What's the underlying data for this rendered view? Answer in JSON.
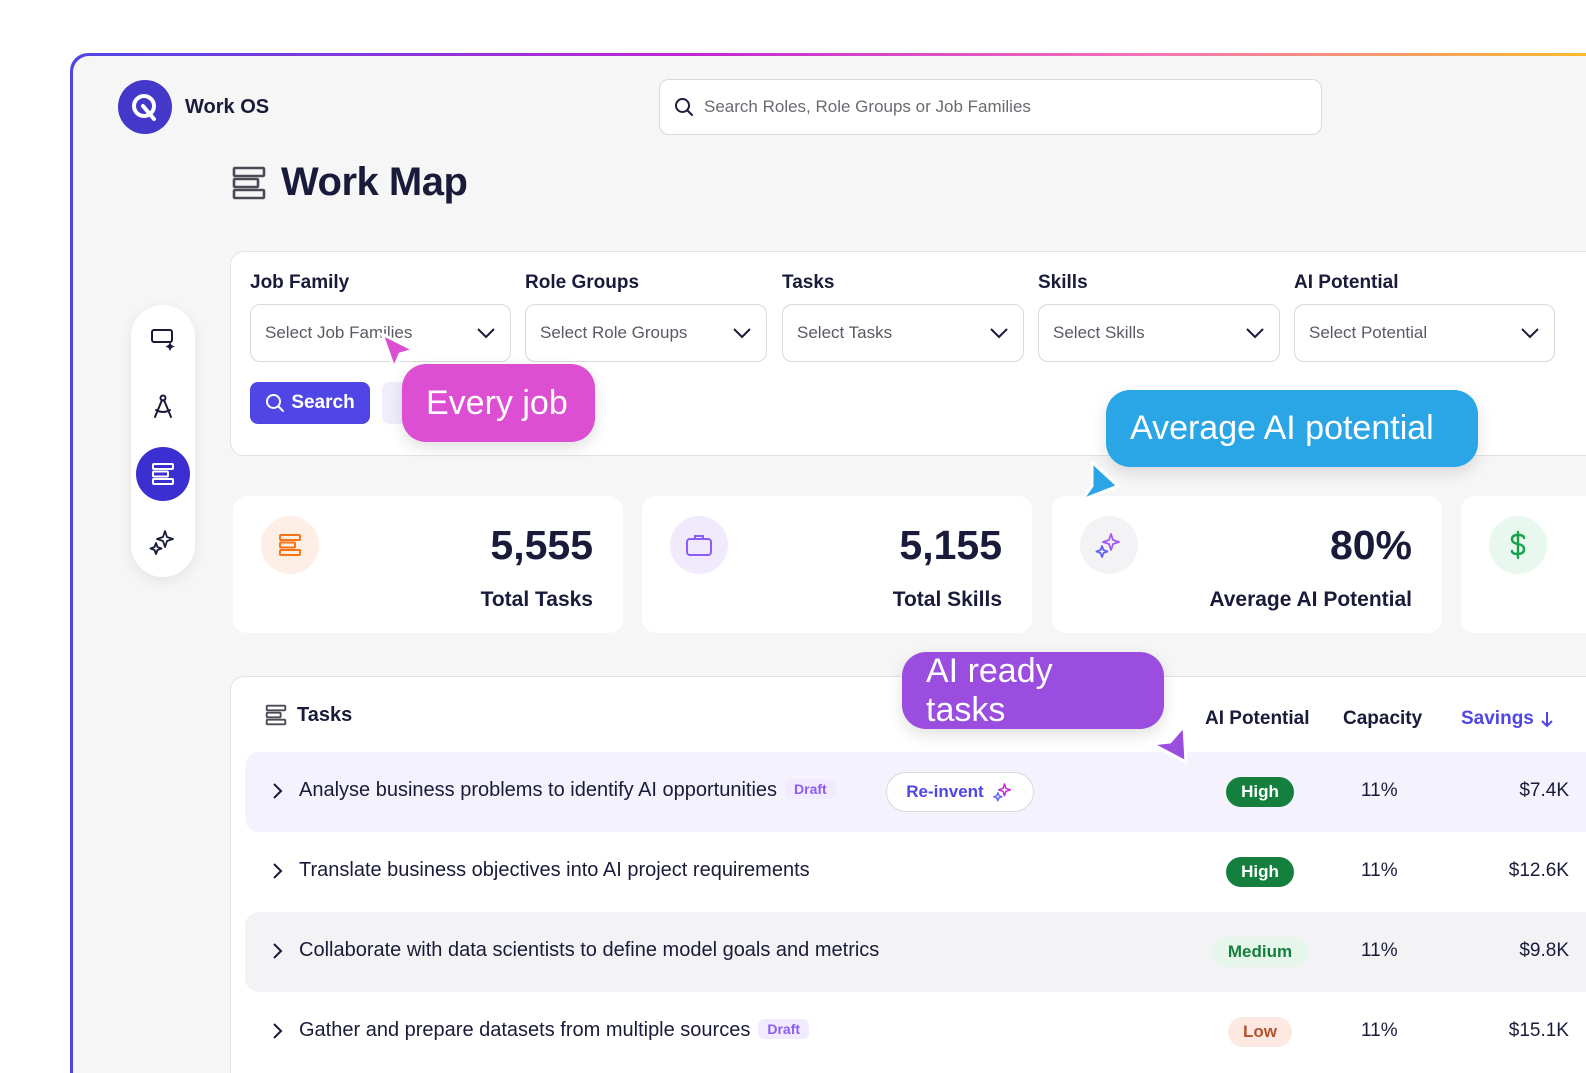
{
  "app": {
    "brand": "Work OS"
  },
  "search": {
    "placeholder": "Search Roles, Role Groups or Job Families"
  },
  "page": {
    "title": "Work Map"
  },
  "filters": [
    {
      "label": "Job Family",
      "placeholder": "Select Job Families"
    },
    {
      "label": "Role Groups",
      "placeholder": "Select Role Groups"
    },
    {
      "label": "Tasks",
      "placeholder": "Select Tasks"
    },
    {
      "label": "Skills",
      "placeholder": "Select Skills"
    },
    {
      "label": "AI Potential",
      "placeholder": "Select Potential"
    }
  ],
  "search_button": {
    "label": "Search"
  },
  "stats": [
    {
      "value": "5,555",
      "label": "Total Tasks",
      "icon": "stack-icon",
      "color": "#f97316"
    },
    {
      "value": "5,155",
      "label": "Total Skills",
      "icon": "briefcase-icon",
      "color": "#8b5cf6"
    },
    {
      "value": "80%",
      "label": "Average AI Potential",
      "icon": "sparkles-icon",
      "color": "#7c3aed"
    },
    {
      "value": "",
      "label": "",
      "icon": "dollar-icon",
      "color": "#16a34a"
    }
  ],
  "tasks": {
    "title": "Tasks",
    "columns": {
      "ai_potential": "AI Potential",
      "capacity": "Capacity",
      "savings": "Savings"
    },
    "rows": [
      {
        "name": "Analyse business problems to identify AI opportunities",
        "draft": "Draft",
        "action": "Re-invent",
        "potential": "High",
        "capacity": "11%",
        "savings": "$7.4K"
      },
      {
        "name": "Translate business objectives into AI project requirements",
        "draft": "",
        "action": "",
        "potential": "High",
        "capacity": "11%",
        "savings": "$12.6K"
      },
      {
        "name": "Collaborate with data scientists to define model goals and metrics",
        "draft": "",
        "action": "",
        "potential": "Medium",
        "capacity": "11%",
        "savings": "$9.8K"
      },
      {
        "name": "Gather and prepare datasets from multiple sources",
        "draft": "Draft",
        "action": "",
        "potential": "Low",
        "capacity": "11%",
        "savings": "$15.1K"
      }
    ]
  },
  "callouts": {
    "every_job": "Every job",
    "average_ai": "Average AI potential",
    "ai_ready": "AI ready tasks"
  },
  "colors": {
    "accent": "#4f46e5",
    "high": "#15803d",
    "pink": "#dc4fd2",
    "blue": "#2aa6e6",
    "purple": "#9b4ddf"
  }
}
